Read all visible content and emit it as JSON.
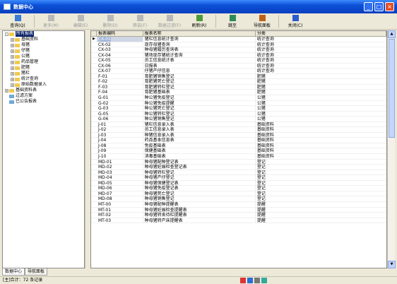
{
  "window": {
    "title": "数据中心"
  },
  "toolbar": [
    {
      "label": "查询(Q)",
      "icon": "search-icon",
      "enabled": true
    },
    {
      "label": "更多(M)",
      "icon": "more-icon",
      "enabled": false
    },
    {
      "label": "编辑(E)",
      "icon": "edit-icon",
      "enabled": false
    },
    {
      "label": "删除(D)",
      "icon": "delete-icon",
      "enabled": false
    },
    {
      "label": "筛选(F)",
      "icon": "filter-icon",
      "enabled": false
    },
    {
      "label": "数据过滤(F)",
      "icon": "data-filter-icon",
      "enabled": false
    },
    {
      "label": "刷新(R)",
      "icon": "refresh-icon",
      "enabled": true
    },
    {
      "label": "跳至",
      "icon": "goto-icon",
      "enabled": true
    },
    {
      "label": "导航面板",
      "icon": "nav-panel-icon",
      "enabled": true
    },
    {
      "label": "关闭(C)",
      "icon": "close-icon",
      "enabled": true
    }
  ],
  "tree": [
    {
      "label": "所有报表",
      "level": 0,
      "toggle": "-",
      "folder": "yellow",
      "selected": true
    },
    {
      "label": "基础资料",
      "level": 1,
      "toggle": "+",
      "folder": "yellow"
    },
    {
      "label": "母猪",
      "level": 1,
      "toggle": "+",
      "folder": "yellow"
    },
    {
      "label": "仔猪",
      "level": 1,
      "toggle": "+",
      "folder": "yellow"
    },
    {
      "label": "公猪",
      "level": 1,
      "toggle": "+",
      "folder": "yellow"
    },
    {
      "label": "药品管理",
      "level": 1,
      "toggle": "+",
      "folder": "yellow"
    },
    {
      "label": "肥猪",
      "level": 1,
      "toggle": "+",
      "folder": "yellow"
    },
    {
      "label": "猪栏",
      "level": 1,
      "toggle": "+",
      "folder": "yellow"
    },
    {
      "label": "统计查询",
      "level": 1,
      "toggle": "+",
      "folder": "yellow"
    },
    {
      "label": "原始数据录入",
      "level": 1,
      "toggle": "+",
      "folder": "yellow"
    },
    {
      "label": "基础资料表",
      "level": 0,
      "toggle": "+",
      "folder": "yellow"
    },
    {
      "label": "过滤方案",
      "level": 0,
      "toggle": "",
      "folder": "blue"
    },
    {
      "label": "已公告报表",
      "level": 0,
      "toggle": "",
      "folder": "blue"
    }
  ],
  "table": {
    "headers": [
      "报表编码",
      "报表名称",
      "分类"
    ],
    "rows": [
      [
        "CX-01",
        "猪栏信息统计查询",
        "统计查询"
      ],
      [
        "CX-02",
        "现存母猪查询",
        "统计查询"
      ],
      [
        "CX-03",
        "种母猪履历查询表",
        "统计查询"
      ],
      [
        "CX-04",
        "猪场现存猪统计查询",
        "统计查询"
      ],
      [
        "CX-05",
        "员工信息统计表",
        "统计查询"
      ],
      [
        "CX-06",
        "日报表",
        "统计查询"
      ],
      [
        "CX-07",
        "仔猪产仔信息",
        "统计查询"
      ],
      [
        "F-01",
        "育肥猪销售登记",
        "肥猪"
      ],
      [
        "F-02",
        "育肥猪死亡登记",
        "肥猪"
      ],
      [
        "F-03",
        "育肥猪转栏登记",
        "肥猪"
      ],
      [
        "F-04",
        "育肥猪基础表",
        "肥猪"
      ],
      [
        "G-01",
        "种公猪免疫登记",
        "公猪"
      ],
      [
        "G-02",
        "种公猪免疫提醒",
        "公猪"
      ],
      [
        "G-03",
        "种公猪死亡登记",
        "公猪"
      ],
      [
        "G-05",
        "种公猪转栏登记",
        "公猪"
      ],
      [
        "G-06",
        "种公猪销售登记",
        "公猪"
      ],
      [
        "J-01",
        "猪栏信息录入表",
        "基础资料"
      ],
      [
        "J-02",
        "员工信息录入表",
        "基础资料"
      ],
      [
        "J-03",
        "种猪信息录入表",
        "基础资料"
      ],
      [
        "J-04",
        "药品基本信息表",
        "基础资料"
      ],
      [
        "J-08",
        "免疫基础表",
        "基础资料"
      ],
      [
        "J-09",
        "保健基础表",
        "基础资料"
      ],
      [
        "J-10",
        "消毒基础表",
        "基础资料"
      ],
      [
        "MD-01",
        "种母猪配种登记表",
        "登记"
      ],
      [
        "MD-02",
        "种母猪妊娠检查登记表",
        "登记"
      ],
      [
        "MD-03",
        "种母猪转栏登记",
        "登记"
      ],
      [
        "MD-04",
        "种母猪产仔登记",
        "登记"
      ],
      [
        "MD-05",
        "种母猪保健登记表",
        "登记"
      ],
      [
        "MD-06",
        "种母猪免疫登记表",
        "登记"
      ],
      [
        "MD-07",
        "种母猪死亡登记",
        "登记"
      ],
      [
        "MD-08",
        "种母猪销售登记",
        "登记"
      ],
      [
        "MT-00",
        "种母猪配种提醒表",
        "提醒"
      ],
      [
        "MT-01",
        "种母猪妊娠检查提醒表",
        "提醒"
      ],
      [
        "MT-02",
        "种母猪转舍待栏提醒表",
        "提醒"
      ],
      [
        "MT-03",
        "种母猪转产床提醒表",
        "提醒"
      ]
    ]
  },
  "tabs": [
    "数据中心",
    "导航面板"
  ],
  "status": {
    "text": "[主]合计：72 条记录"
  }
}
